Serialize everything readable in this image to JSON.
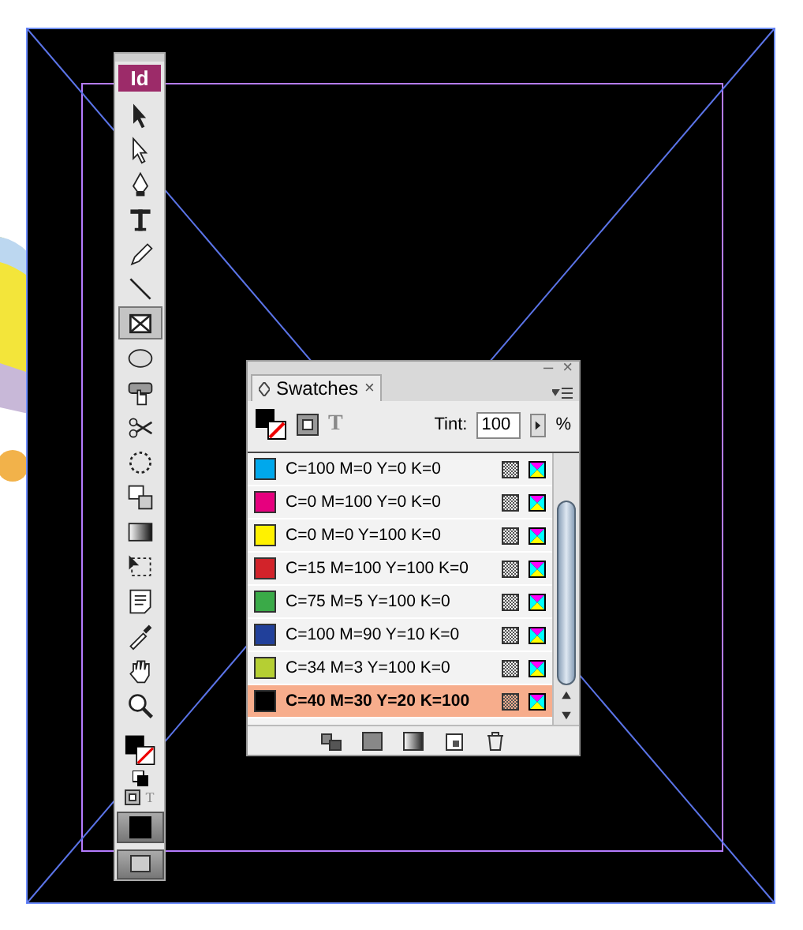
{
  "toolbox": {
    "logo": "Id",
    "tools": [
      {
        "kind": "selection",
        "selected": false
      },
      {
        "kind": "direct",
        "selected": false
      },
      {
        "kind": "pen",
        "selected": false
      },
      {
        "kind": "type",
        "selected": false
      },
      {
        "kind": "pencil",
        "selected": false
      },
      {
        "kind": "line",
        "selected": false
      },
      {
        "kind": "frame",
        "selected": true
      },
      {
        "kind": "ellipse",
        "selected": false
      },
      {
        "kind": "button",
        "selected": false
      },
      {
        "kind": "scissors",
        "selected": false
      },
      {
        "kind": "rotate",
        "selected": false
      },
      {
        "kind": "scale",
        "selected": false
      },
      {
        "kind": "gradient",
        "selected": false
      },
      {
        "kind": "transform",
        "selected": false
      },
      {
        "kind": "note",
        "selected": false
      },
      {
        "kind": "eyedropper",
        "selected": false
      },
      {
        "kind": "hand",
        "selected": false
      },
      {
        "kind": "zoom",
        "selected": false
      }
    ],
    "format_text": "T"
  },
  "swatches_panel": {
    "minimize": "–",
    "close": "×",
    "tab": {
      "title": "Swatches",
      "close": "×"
    },
    "text_mode": "T",
    "tint_label": "Tint:",
    "tint_value": "100",
    "tint_unit": "%",
    "swatches": [
      {
        "name": "C=100 M=0 Y=0 K=0",
        "color": "#00a8ec",
        "selected": false
      },
      {
        "name": "C=0 M=100 Y=0 K=0",
        "color": "#e6007e",
        "selected": false
      },
      {
        "name": "C=0 M=0 Y=100 K=0",
        "color": "#fff100",
        "selected": false
      },
      {
        "name": "C=15 M=100 Y=100 K=0",
        "color": "#d2232a",
        "selected": false
      },
      {
        "name": "C=75 M=5 Y=100 K=0",
        "color": "#3aaa48",
        "selected": false
      },
      {
        "name": "C=100 M=90 Y=10 K=0",
        "color": "#21409a",
        "selected": false
      },
      {
        "name": "C=34 M=3 Y=100 K=0",
        "color": "#b5cf33",
        "selected": false
      },
      {
        "name": "C=40 M=30 Y=20 K=100",
        "color": "#000000",
        "selected": true
      }
    ]
  }
}
